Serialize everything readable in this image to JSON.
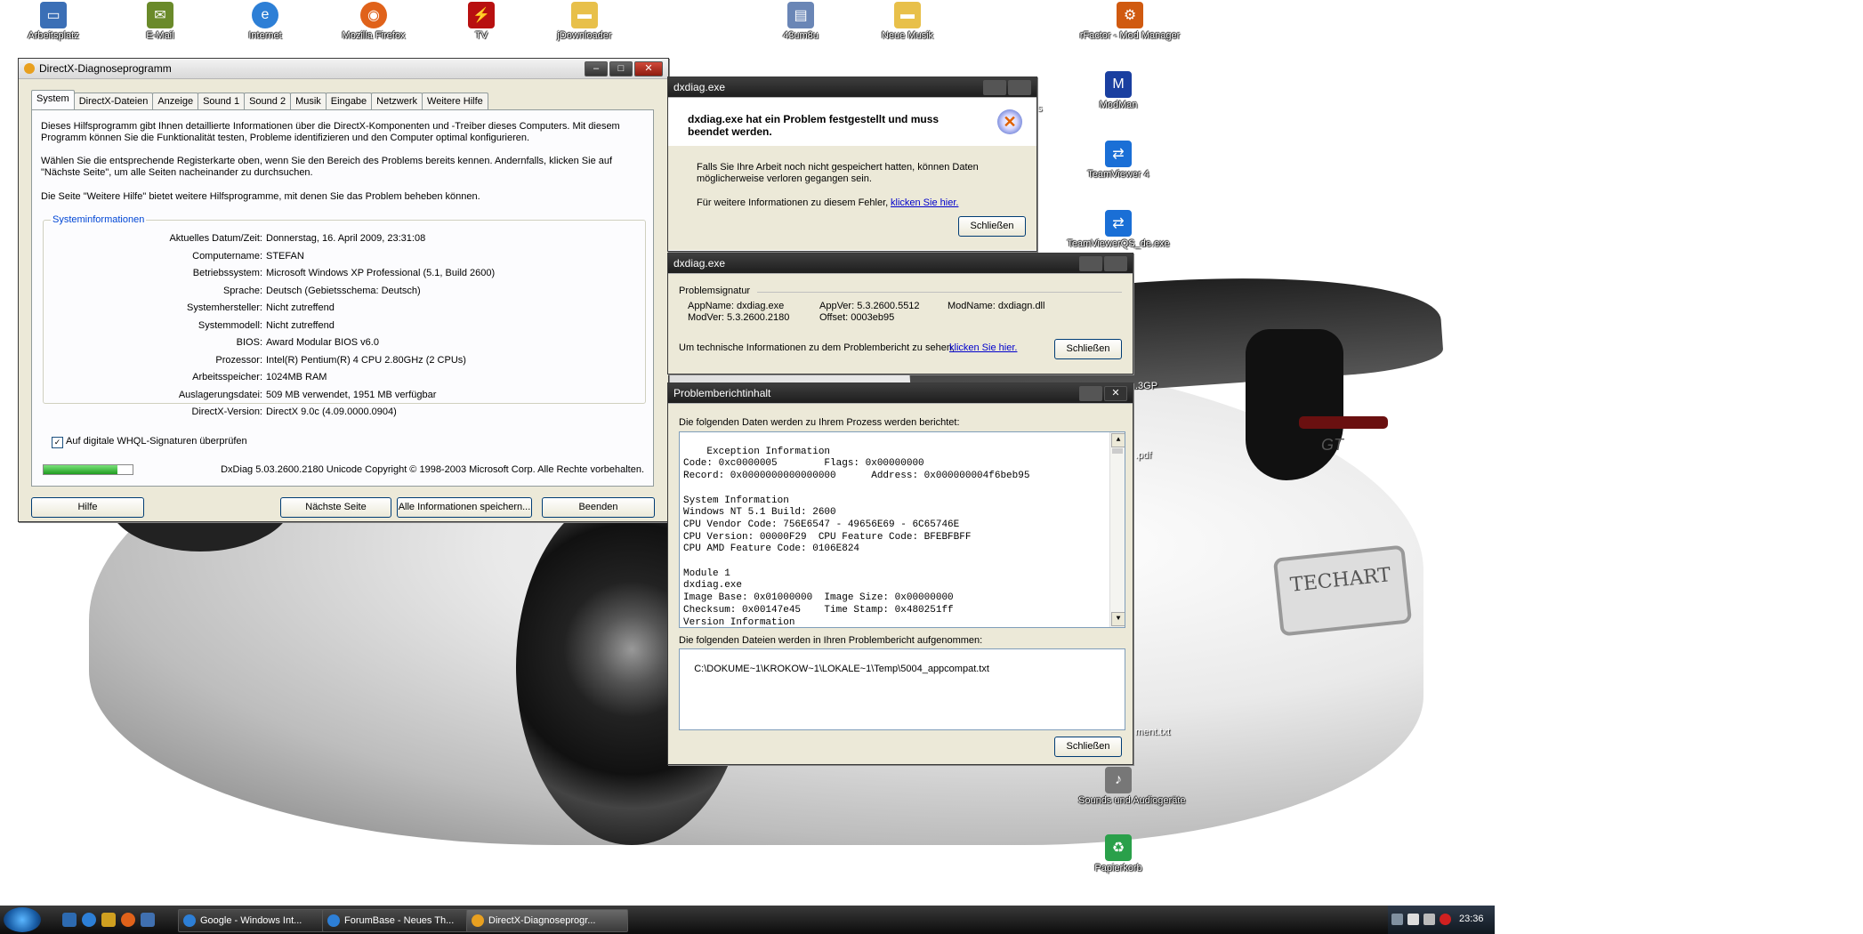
{
  "desktop_icons": [
    {
      "label": "Arbeitsplatz",
      "icon": "computer-icon",
      "color": "#3b6fb6"
    },
    {
      "label": "E-Mail",
      "icon": "mail-icon",
      "color": "#6a8a2a"
    },
    {
      "label": "Internet",
      "icon": "internet-explorer-icon",
      "color": "#2d7fd6"
    },
    {
      "label": "Mozilla Firefox",
      "icon": "firefox-icon",
      "color": "#e0621a"
    },
    {
      "label": "TV",
      "icon": "tv-icon",
      "color": "#b81010"
    },
    {
      "label": "jDownloader",
      "icon": "folder-icon",
      "color": "#e8c04a"
    },
    {
      "label": "43um8u",
      "icon": "file-icon",
      "color": "#6a86b6"
    },
    {
      "label": "Neue Musik",
      "icon": "folder-icon",
      "color": "#e8c04a"
    },
    {
      "label": "rFactor - Mod Manager",
      "icon": "rfactor-icon",
      "color": "#d05a10"
    },
    {
      "label": "ModMan",
      "icon": "modman-icon",
      "color": "#1a3fa0"
    },
    {
      "label": "TeamViewer 4",
      "icon": "teamviewer-icon",
      "color": "#1a6fd6"
    },
    {
      "label": "TeamViewerQS_de.exe",
      "icon": "teamviewer-icon",
      "color": "#1a6fd6"
    },
    {
      "label": "Sounds und Audiogeräte",
      "icon": "sound-icon",
      "color": "#777777"
    },
    {
      "label": "Papierkorb",
      "icon": "recycle-bin-icon",
      "color": "#2aa04a"
    }
  ],
  "desktop_partial_labels": [
    "s",
    ".3GP",
    ".pdf",
    "ment.txt"
  ],
  "dxdiag": {
    "title": "DirectX-Diagnoseprogramm",
    "tabs": [
      "System",
      "DirectX-Dateien",
      "Anzeige",
      "Sound 1",
      "Sound 2",
      "Musik",
      "Eingabe",
      "Netzwerk",
      "Weitere Hilfe"
    ],
    "intro1": "Dieses Hilfsprogramm gibt Ihnen detaillierte Informationen über die DirectX-Komponenten und -Treiber dieses Computers. Mit diesem Programm können Sie die Funktionalität testen, Probleme identifizieren und den Computer optimal konfigurieren.",
    "intro2": "Wählen Sie die entsprechende Registerkarte oben, wenn Sie den Bereich des Problems bereits kennen. Andernfalls, klicken Sie auf \"Nächste Seite\", um alle Seiten nacheinander zu durchsuchen.",
    "intro3": "Die Seite \"Weitere Hilfe\" bietet weitere Hilfsprogramme, mit denen Sie das Problem beheben können.",
    "group_title": "Systeminformationen",
    "info": [
      {
        "k": "Aktuelles Datum/Zeit:",
        "v": "Donnerstag, 16. April 2009, 23:31:08"
      },
      {
        "k": "Computername:",
        "v": "STEFAN"
      },
      {
        "k": "Betriebssystem:",
        "v": "Microsoft Windows XP Professional (5.1, Build 2600)"
      },
      {
        "k": "Sprache:",
        "v": "Deutsch (Gebietsschema: Deutsch)"
      },
      {
        "k": "Systemhersteller:",
        "v": "Nicht zutreffend"
      },
      {
        "k": "Systemmodell:",
        "v": "Nicht zutreffend"
      },
      {
        "k": "BIOS:",
        "v": "Award Modular BIOS v6.0"
      },
      {
        "k": "Prozessor:",
        "v": "Intel(R) Pentium(R) 4 CPU 2.80GHz (2 CPUs)"
      },
      {
        "k": "Arbeitsspeicher:",
        "v": "1024MB RAM"
      },
      {
        "k": "Auslagerungsdatei:",
        "v": "509 MB verwendet, 1951 MB verfügbar"
      },
      {
        "k": "DirectX-Version:",
        "v": "DirectX 9.0c (4.09.0000.0904)"
      }
    ],
    "whql_label": "Auf digitale WHQL-Signaturen überprüfen",
    "whql_checked": true,
    "progress_fraction": 0.83,
    "footer": "DxDiag 5.03.2600.2180 Unicode  Copyright © 1998-2003 Microsoft Corp. Alle Rechte vorbehalten.",
    "buttons": {
      "help": "Hilfe",
      "next": "Nächste Seite",
      "save": "Alle Informationen speichern...",
      "exit": "Beenden"
    }
  },
  "err1": {
    "title": "dxdiag.exe",
    "heading": "dxdiag.exe hat ein Problem festgestellt und muss beendet werden.",
    "body": "Falls Sie Ihre Arbeit noch nicht gespeichert hatten, können Daten möglicherweise verloren gegangen sein.",
    "more": "Für weitere Informationen zu diesem Fehler,",
    "link": "klicken Sie hier.",
    "close": "Schließen"
  },
  "err2": {
    "title": "dxdiag.exe",
    "section": "Problemsignatur",
    "appname": "AppName: dxdiag.exe",
    "appver": "AppVer: 5.3.2600.5512",
    "modname": "ModName: dxdiagn.dll",
    "modver": "ModVer: 5.3.2600.2180",
    "offset": "Offset: 0003eb95",
    "tech": "Um technische Informationen zu dem Problembericht zu sehen,",
    "link": "klicken Sie hier.",
    "close": "Schließen"
  },
  "err3": {
    "title": "Problemberichtinhalt",
    "intro": "Die folgenden Daten werden zu Ihrem Prozess werden berichtet:",
    "report": "Exception Information\nCode: 0xc0000005        Flags: 0x00000000\nRecord: 0x0000000000000000      Address: 0x000000004f6beb95\n\nSystem Information\nWindows NT 5.1 Build: 2600\nCPU Vendor Code: 756E6547 - 49656E69 - 6C65746E\nCPU Version: 00000F29  CPU Feature Code: BFEBFBFF\nCPU AMD Feature Code: 0106E824\n\nModule 1\ndxdiag.exe\nImage Base: 0x01000000  Image Size: 0x00000000\nChecksum: 0x00147e45    Time Stamp: 0x480251ff\nVersion Information",
    "files_intro": "Die folgenden Dateien werden in Ihren Problembericht aufgenommen:",
    "file": "C:\\DOKUME~1\\KROKOW~1\\LOKALE~1\\Temp\\5004_appcompat.txt",
    "close": "Schließen"
  },
  "car": {
    "badge": "GT",
    "plate": "TECHART"
  },
  "taskbar": {
    "items": [
      "Google - Windows Int...",
      "ForumBase - Neues Th...",
      "DirectX-Diagnoseprogr..."
    ],
    "clock": "23:36"
  }
}
